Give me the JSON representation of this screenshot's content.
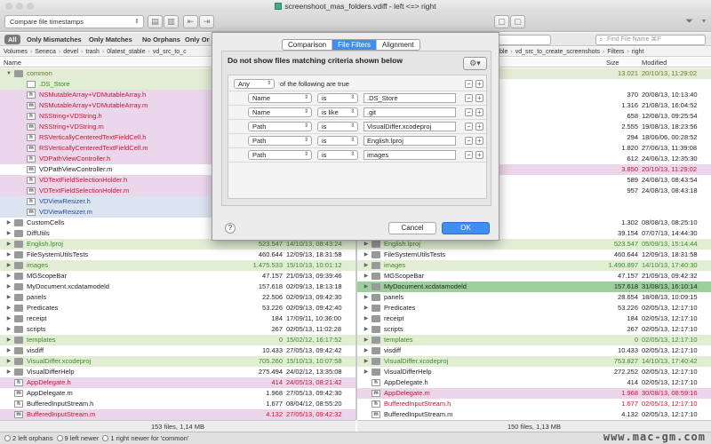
{
  "window": {
    "title": "screenshoot_mas_folders.vdiff - left <=> right"
  },
  "toolbar": {
    "compare_mode": "Compare file timestamps"
  },
  "filters": [
    "All",
    "Only Mismatches",
    "Only Matches",
    "No Orphans",
    "Only Or"
  ],
  "search": {
    "placeholder": "Find File Name ⌘F"
  },
  "left": {
    "breadcrumb": [
      "Volumes",
      "Seneca",
      "devel",
      "trash",
      "0latest_stable",
      "vd_src_to_c"
    ],
    "col_name": "Name",
    "footer": "153 files, 1,14 MB",
    "rows": [
      {
        "level": 0,
        "tri": "▼",
        "icon": "folder",
        "name": "common",
        "size": "",
        "date": "",
        "state": "gold"
      },
      {
        "level": 1,
        "tri": "",
        "icon": "file",
        "name": ".DS_Store",
        "size": "",
        "date": "",
        "state": "green"
      },
      {
        "level": 1,
        "tri": "",
        "icon": "h",
        "name": "NSMutableArray+VDMutableArray.h",
        "size": "",
        "date": "",
        "state": "pink"
      },
      {
        "level": 1,
        "tri": "",
        "icon": "m",
        "name": "NSMutableArray+VDMutableArray.m",
        "size": "",
        "date": "",
        "state": "pink"
      },
      {
        "level": 1,
        "tri": "",
        "icon": "h",
        "name": "NSString+VDString.h",
        "size": "",
        "date": "",
        "state": "pink"
      },
      {
        "level": 1,
        "tri": "",
        "icon": "m",
        "name": "NSString+VDString.m",
        "size": "",
        "date": "",
        "state": "pink"
      },
      {
        "level": 1,
        "tri": "",
        "icon": "h",
        "name": "RSVerticallyCenteredTextFieldCell.h",
        "size": "",
        "date": "",
        "state": "pink"
      },
      {
        "level": 1,
        "tri": "",
        "icon": "m",
        "name": "RSVerticallyCenteredTextFieldCell.m",
        "size": "",
        "date": "",
        "state": "pink"
      },
      {
        "level": 1,
        "tri": "",
        "icon": "h",
        "name": "VDPathViewController.h",
        "size": "",
        "date": "",
        "state": "pink"
      },
      {
        "level": 1,
        "tri": "",
        "icon": "m",
        "name": "VDPathViewController.m",
        "size": "",
        "date": "",
        "state": "blank"
      },
      {
        "level": 1,
        "tri": "",
        "icon": "h",
        "name": "VDTextFieldSelectionHolder.h",
        "size": "",
        "date": "",
        "state": "pink"
      },
      {
        "level": 1,
        "tri": "",
        "icon": "m",
        "name": "VDTextFieldSelectionHolder.m",
        "size": "",
        "date": "",
        "state": "pink"
      },
      {
        "level": 1,
        "tri": "",
        "icon": "h",
        "name": "VDViewResizer.h",
        "size": "",
        "date": "",
        "state": "blue"
      },
      {
        "level": 1,
        "tri": "",
        "icon": "m",
        "name": "VDViewResizer.m",
        "size": "",
        "date": "",
        "state": "blue"
      },
      {
        "level": 0,
        "tri": "▶",
        "icon": "folder",
        "name": "CustomCells",
        "size": "",
        "date": "",
        "state": "blank"
      },
      {
        "level": 0,
        "tri": "▶",
        "icon": "folder",
        "name": "DiffUtils",
        "size": "",
        "date": "",
        "state": "blank"
      },
      {
        "level": 0,
        "tri": "▶",
        "icon": "folder",
        "name": "English.lproj",
        "size": "523.547",
        "date": "14/10/13, 08:43:24",
        "state": "green"
      },
      {
        "level": 0,
        "tri": "▶",
        "icon": "folder",
        "name": "FileSystemUtilsTests",
        "size": "460.644",
        "date": "12/09/13, 18:31:58",
        "state": "blank"
      },
      {
        "level": 0,
        "tri": "▶",
        "icon": "folder",
        "name": "images",
        "size": "1.475.533",
        "date": "15/10/13, 10:01:12",
        "state": "green"
      },
      {
        "level": 0,
        "tri": "▶",
        "icon": "folder",
        "name": "MGScopeBar",
        "size": "47.157",
        "date": "21/09/13, 09:39:46",
        "state": "blank"
      },
      {
        "level": 0,
        "tri": "▶",
        "icon": "folder",
        "name": "MyDocument.xcdatamodeld",
        "size": "157.618",
        "date": "02/09/13, 18:13:18",
        "state": "blank"
      },
      {
        "level": 0,
        "tri": "▶",
        "icon": "folder",
        "name": "panels",
        "size": "22.506",
        "date": "02/09/13, 09:42:30",
        "state": "blank"
      },
      {
        "level": 0,
        "tri": "▶",
        "icon": "folder",
        "name": "Predicates",
        "size": "53.226",
        "date": "02/09/13, 09:42:40",
        "state": "blank"
      },
      {
        "level": 0,
        "tri": "▶",
        "icon": "folder",
        "name": "receipt",
        "size": "184",
        "date": "17/09/11, 10:36:00",
        "state": "blank"
      },
      {
        "level": 0,
        "tri": "▶",
        "icon": "folder",
        "name": "scripts",
        "size": "267",
        "date": "02/05/13, 11:02:28",
        "state": "blank"
      },
      {
        "level": 0,
        "tri": "▶",
        "icon": "folder",
        "name": "templates",
        "size": "0",
        "date": "15/02/12, 16:17:52",
        "state": "green"
      },
      {
        "level": 0,
        "tri": "▶",
        "icon": "folder",
        "name": "visdiff",
        "size": "10.433",
        "date": "27/05/13, 09:42:42",
        "state": "blank"
      },
      {
        "level": 0,
        "tri": "▶",
        "icon": "folder",
        "name": "VisualDiffer.xcodeproj",
        "size": "705.260",
        "date": "15/10/13, 10:07:58",
        "state": "green"
      },
      {
        "level": 0,
        "tri": "▶",
        "icon": "folder",
        "name": "VisualDifferHelp",
        "size": "275.494",
        "date": "24/02/12, 13:35:08",
        "state": "blank"
      },
      {
        "level": 0,
        "tri": "",
        "icon": "h",
        "name": "AppDelegate.h",
        "size": "414",
        "date": "24/05/13, 08:21:42",
        "state": "pink"
      },
      {
        "level": 0,
        "tri": "",
        "icon": "m",
        "name": "AppDelegate.m",
        "size": "1.968",
        "date": "27/05/13, 09:42:30",
        "state": "blank"
      },
      {
        "level": 0,
        "tri": "",
        "icon": "h",
        "name": "BufferedInputStream.h",
        "size": "1.677",
        "date": "08/04/12, 08:55:20",
        "state": "blank"
      },
      {
        "level": 0,
        "tri": "",
        "icon": "m",
        "name": "BufferedInputStream.m",
        "size": "4.132",
        "date": "27/05/13, 09:42:32",
        "state": "pink"
      }
    ]
  },
  "right": {
    "breadcrumb": [
      "ble",
      "vd_src_to_create_screenshots",
      "Filters",
      "right"
    ],
    "col_size": "Size",
    "col_modified": "Modified",
    "footer": "150 files, 1,13 MB",
    "rows": [
      {
        "level": 0,
        "tri": "",
        "icon": "",
        "name": "",
        "size": "13.021",
        "date": "20/10/13, 11:29:02",
        "state": "gold"
      },
      {
        "level": 0,
        "tri": "",
        "icon": "",
        "name": "",
        "size": "",
        "date": "",
        "state": "blank"
      },
      {
        "level": 0,
        "tri": "",
        "icon": "",
        "name": "",
        "size": "370",
        "date": "20/08/13, 10:13:40",
        "state": "blank"
      },
      {
        "level": 0,
        "tri": "",
        "icon": "",
        "name": "",
        "size": "1.316",
        "date": "21/08/13, 16:04:52",
        "state": "blank"
      },
      {
        "level": 0,
        "tri": "",
        "icon": "",
        "name": "",
        "size": "658",
        "date": "12/08/13, 09:25:54",
        "state": "blank"
      },
      {
        "level": 0,
        "tri": "",
        "icon": "",
        "name": "",
        "size": "2.555",
        "date": "19/08/13, 18:23:56",
        "state": "blank"
      },
      {
        "level": 0,
        "tri": "",
        "icon": "",
        "name": "",
        "size": "294",
        "date": "18/06/06, 00:28:52",
        "state": "blank"
      },
      {
        "level": 0,
        "tri": "",
        "icon": "",
        "name": "",
        "size": "1.820",
        "date": "27/06/13, 11:39:08",
        "state": "blank"
      },
      {
        "level": 0,
        "tri": "",
        "icon": "",
        "name": "",
        "size": "612",
        "date": "24/06/13, 12:35:30",
        "state": "blank"
      },
      {
        "level": 0,
        "tri": "",
        "icon": "",
        "name": "",
        "size": "3.850",
        "date": "20/10/13, 11:29:02",
        "state": "pink"
      },
      {
        "level": 0,
        "tri": "",
        "icon": "",
        "name": "",
        "size": "589",
        "date": "24/08/13, 08:43:54",
        "state": "blank"
      },
      {
        "level": 0,
        "tri": "",
        "icon": "",
        "name": "",
        "size": "957",
        "date": "24/08/13, 08:43:18",
        "state": "blank"
      },
      {
        "level": 0,
        "tri": "",
        "icon": "",
        "name": "",
        "size": "",
        "date": "",
        "state": "blank"
      },
      {
        "level": 0,
        "tri": "",
        "icon": "",
        "name": "",
        "size": "",
        "date": "",
        "state": "blank"
      },
      {
        "level": 0,
        "tri": "",
        "icon": "",
        "name": "",
        "size": "1.302",
        "date": "08/08/13, 08:25:10",
        "state": "blank"
      },
      {
        "level": 0,
        "tri": "",
        "icon": "",
        "name": "",
        "size": "39.154",
        "date": "07/07/13, 14:44:30",
        "state": "blank"
      },
      {
        "level": 0,
        "tri": "▶",
        "icon": "folder",
        "name": "English.lproj",
        "size": "523.547",
        "date": "05/09/13, 15:14:44",
        "state": "green"
      },
      {
        "level": 0,
        "tri": "▶",
        "icon": "folder",
        "name": "FileSystemUtilsTests",
        "size": "460.644",
        "date": "12/09/13, 18:31:58",
        "state": "blank"
      },
      {
        "level": 0,
        "tri": "▶",
        "icon": "folder",
        "name": "images",
        "size": "1.490.897",
        "date": "14/10/13, 17:40:30",
        "state": "green"
      },
      {
        "level": 0,
        "tri": "▶",
        "icon": "folder",
        "name": "MGScopeBar",
        "size": "47.157",
        "date": "21/09/13, 09:42:32",
        "state": "blank"
      },
      {
        "level": 0,
        "tri": "▶",
        "icon": "folder",
        "name": "MyDocument.xcdatamodeld",
        "size": "157.618",
        "date": "31/08/13, 16:10:14",
        "state": "sel"
      },
      {
        "level": 0,
        "tri": "▶",
        "icon": "folder",
        "name": "panels",
        "size": "28.654",
        "date": "18/08/13, 10:09:15",
        "state": "blank"
      },
      {
        "level": 0,
        "tri": "▶",
        "icon": "folder",
        "name": "Predicates",
        "size": "53.226",
        "date": "02/05/13, 12:17:10",
        "state": "blank"
      },
      {
        "level": 0,
        "tri": "▶",
        "icon": "folder",
        "name": "receipt",
        "size": "184",
        "date": "02/05/13, 12:17:10",
        "state": "blank"
      },
      {
        "level": 0,
        "tri": "▶",
        "icon": "folder",
        "name": "scripts",
        "size": "267",
        "date": "02/05/13, 12:17:10",
        "state": "blank"
      },
      {
        "level": 0,
        "tri": "▶",
        "icon": "folder",
        "name": "templates",
        "size": "0",
        "date": "02/05/13, 12:17:10",
        "state": "green"
      },
      {
        "level": 0,
        "tri": "▶",
        "icon": "folder",
        "name": "visdiff",
        "size": "10.433",
        "date": "02/05/13, 12:17:10",
        "state": "blank"
      },
      {
        "level": 0,
        "tri": "▶",
        "icon": "folder",
        "name": "VisualDiffer.xcodeproj",
        "size": "753.827",
        "date": "14/10/13, 17:40:42",
        "state": "green"
      },
      {
        "level": 0,
        "tri": "▶",
        "icon": "folder",
        "name": "VisualDifferHelp",
        "size": "272.252",
        "date": "02/05/13, 12:17:10",
        "state": "blank"
      },
      {
        "level": 0,
        "tri": "",
        "icon": "h",
        "name": "AppDelegate.h",
        "size": "414",
        "date": "02/05/13, 12:17:10",
        "state": "blank"
      },
      {
        "level": 0,
        "tri": "",
        "icon": "m",
        "name": "AppDelegate.m",
        "size": "1.968",
        "date": "30/08/13, 08:59:16",
        "state": "pink"
      },
      {
        "level": 0,
        "tri": "",
        "icon": "h",
        "name": "BufferedInputStream.h",
        "size": "1.677",
        "date": "02/05/13, 12:17:10",
        "state": "pink-red"
      },
      {
        "level": 0,
        "tri": "",
        "icon": "m",
        "name": "BufferedInputStream.m",
        "size": "4.132",
        "date": "02/05/13, 12:17:10",
        "state": "blank"
      }
    ]
  },
  "dialog": {
    "tabs": [
      "Comparison",
      "File Filters",
      "Alignment"
    ],
    "active_tab": 1,
    "heading": "Do not show files matching criteria shown below",
    "match_any": "Any",
    "match_suffix": "of the following are true",
    "rules": [
      {
        "field": "Name",
        "op": "is",
        "value": ".DS_Store"
      },
      {
        "field": "Name",
        "op": "is like",
        "value": ".git"
      },
      {
        "field": "Path",
        "op": "is",
        "value": "VisualDiffer.xcodeproj"
      },
      {
        "field": "Path",
        "op": "is",
        "value": "English.lproj"
      },
      {
        "field": "Path",
        "op": "is",
        "value": "images"
      }
    ],
    "help": "?",
    "cancel": "Cancel",
    "ok": "OK",
    "plus": "+",
    "minus": "−"
  },
  "status": {
    "left_orphans": "2 left orphans",
    "left_newer": "9 left newer",
    "right_newer": "1 right newer for 'common'"
  },
  "watermark": "www.mac-gm.com",
  "colors": {
    "accent": "#3f8ff1",
    "mismatch_pink": "#ecd6ec",
    "match_green": "#e2eed4",
    "orphan_red": "#c0182a"
  }
}
